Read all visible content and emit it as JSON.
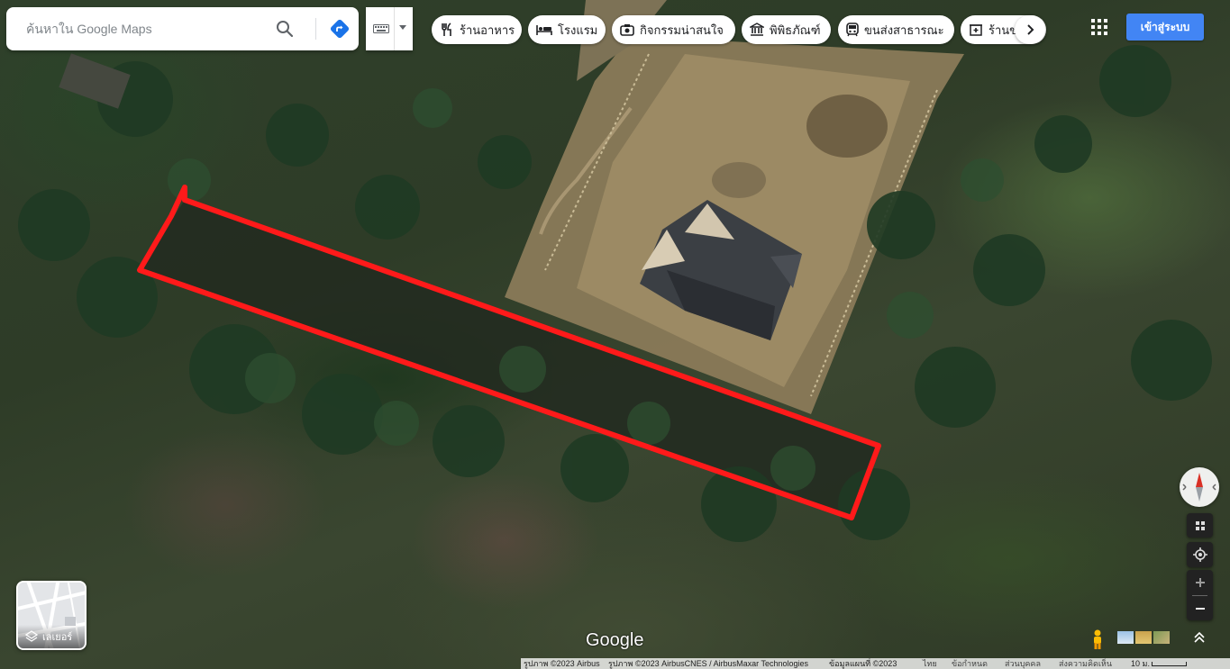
{
  "search": {
    "placeholder": "ค้นหาใน Google Maps"
  },
  "chips": [
    {
      "label": "ร้านอาหาร",
      "icon": "restaurant-icon"
    },
    {
      "label": "โรงแรม",
      "icon": "hotel-icon"
    },
    {
      "label": "กิจกรรมน่าสนใจ",
      "icon": "camera-icon"
    },
    {
      "label": "พิพิธภัณฑ์",
      "icon": "museum-icon"
    },
    {
      "label": "ขนส่งสาธารณะ",
      "icon": "transit-icon"
    },
    {
      "label": "ร้านขายยา",
      "icon": "pharmacy-icon"
    }
  ],
  "header": {
    "signin_label": "เข้าสู่ระบบ"
  },
  "layers": {
    "label": "เลเยอร์"
  },
  "branding": {
    "logo": "Google"
  },
  "footer": {
    "imagery": "รูปภาพ ©2023 Airbus",
    "imagery2": "รูปภาพ ©2023 AirbusCNES / AirbusMaxar Technologies",
    "mapdata": "ข้อมูลแผนที่ ©2023",
    "language": "ไทย",
    "terms": "ข้อกำหนด",
    "privacy": "ส่วนบุคคล",
    "feedback": "ส่งความคิดเห็น",
    "scale": "10 ม."
  },
  "colors": {
    "annotation": "#ff1a1a",
    "signin": "#4285f4"
  }
}
